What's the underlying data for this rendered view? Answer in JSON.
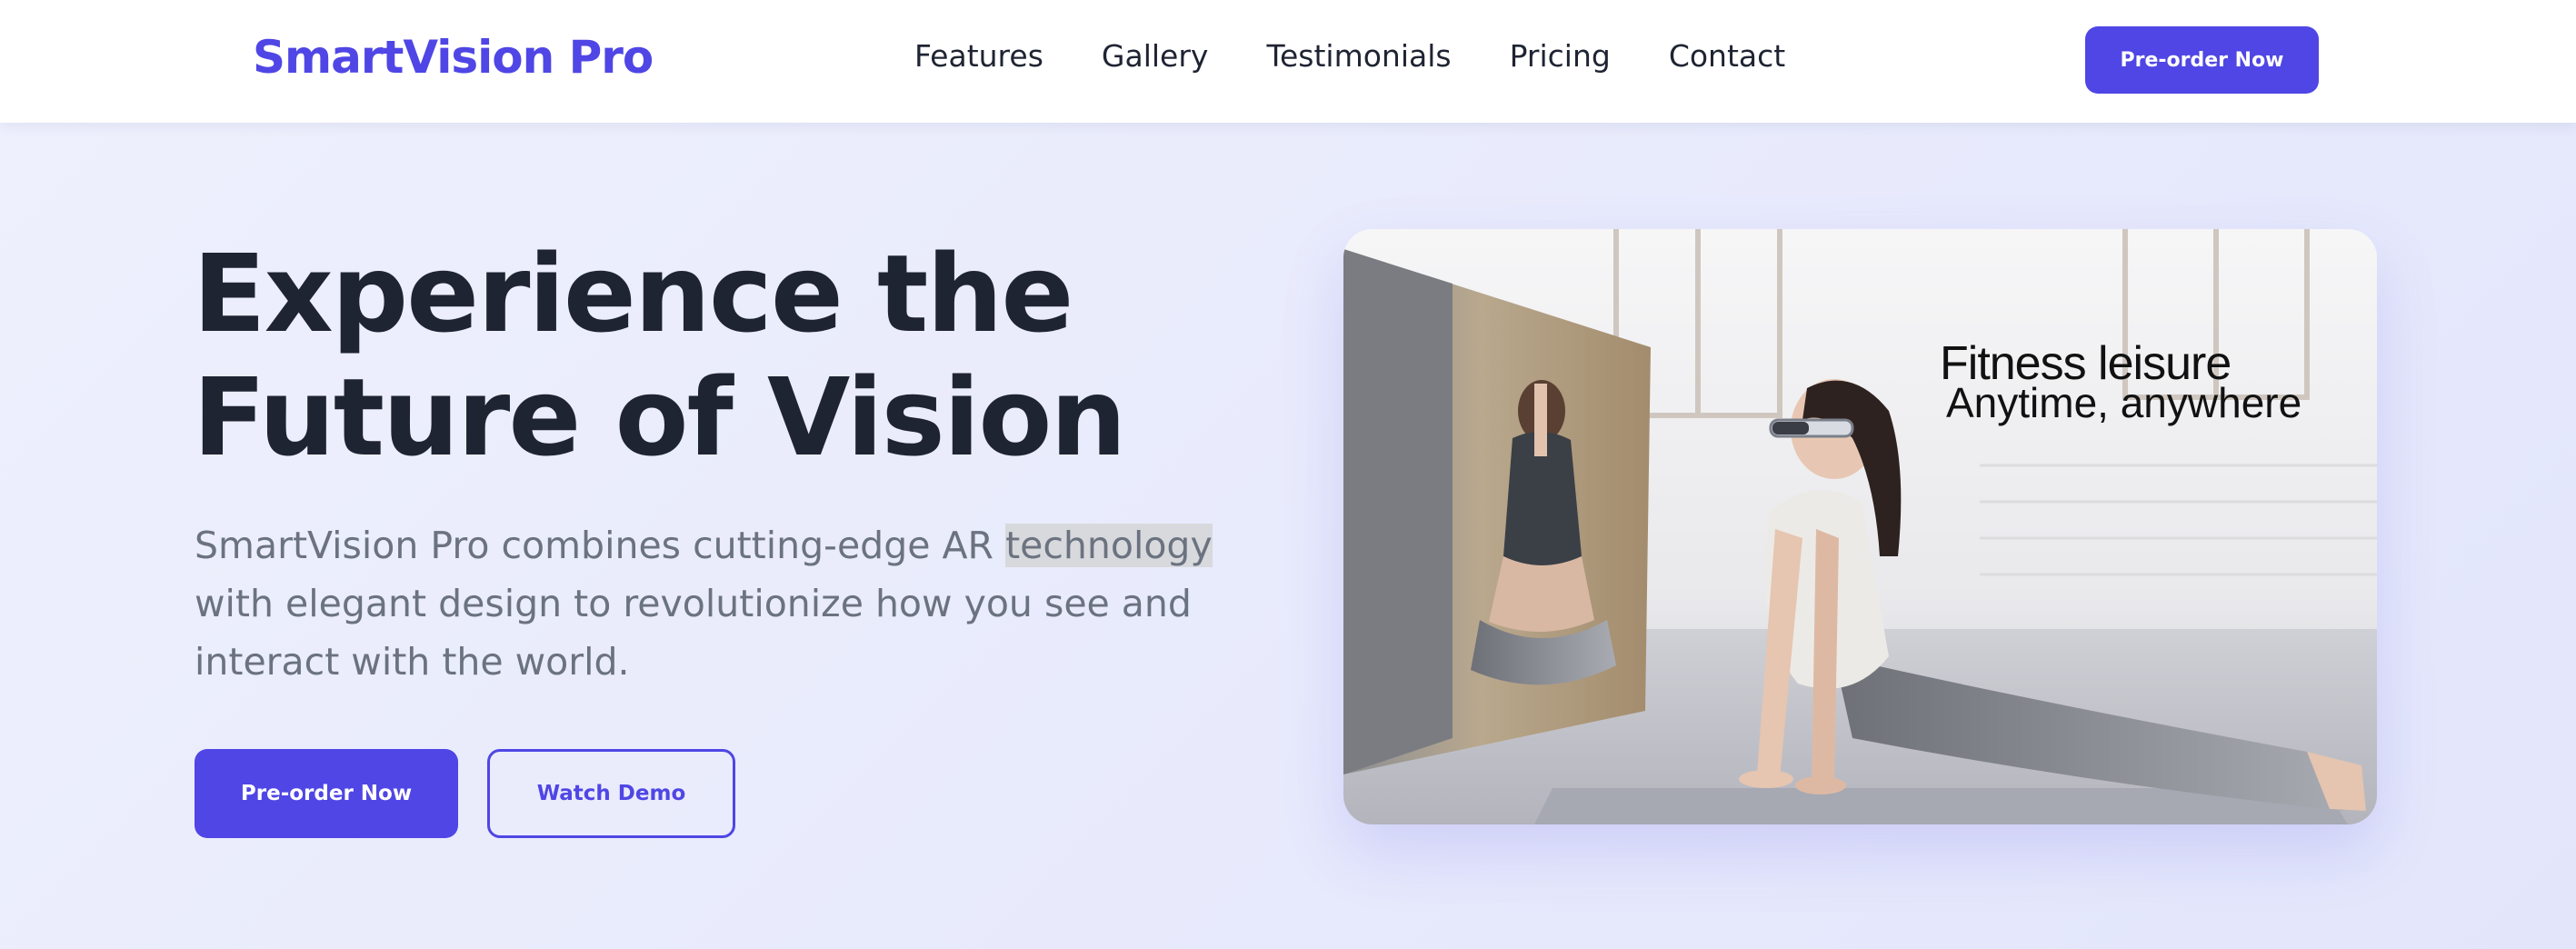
{
  "brand": {
    "name": "SmartVision Pro",
    "accent": "#4f46e5"
  },
  "nav": {
    "links": [
      "Features",
      "Gallery",
      "Testimonials",
      "Pricing",
      "Contact"
    ],
    "cta_label": "Pre-order Now"
  },
  "hero": {
    "title_line1": "Experience the",
    "title_line2": "Future of Vision",
    "desc_before": "SmartVision Pro combines cutting-edge AR ",
    "desc_highlight": "technology",
    "desc_after": " with elegant design to revolutionize how you see and interact with the world.",
    "primary_cta": "Pre-order Now",
    "secondary_cta": "Watch Demo",
    "image": {
      "overlay_line1": "Fitness leisure",
      "overlay_line2": "Anytime, anywhere",
      "icon": "fitness-photo"
    }
  }
}
